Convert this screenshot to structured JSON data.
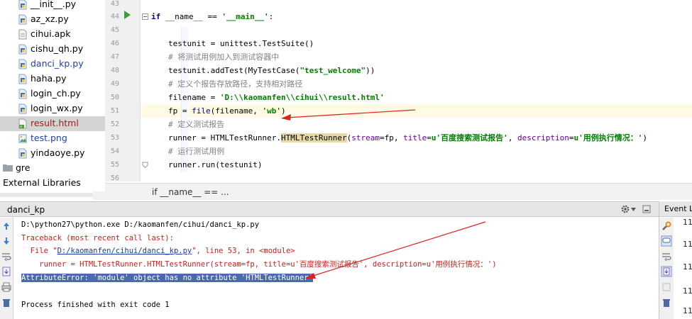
{
  "project_tree": {
    "items": [
      {
        "label": "__init__.py",
        "icon": "python-file-icon",
        "vcs": "none"
      },
      {
        "label": "az_xz.py",
        "icon": "python-file-icon",
        "vcs": "none"
      },
      {
        "label": "cihui.apk",
        "icon": "file-icon",
        "vcs": "none"
      },
      {
        "label": "cishu_qh.py",
        "icon": "python-file-icon",
        "vcs": "none"
      },
      {
        "label": "danci_kp.py",
        "icon": "python-file-icon",
        "vcs": "modified"
      },
      {
        "label": "haha.py",
        "icon": "python-file-icon",
        "vcs": "none"
      },
      {
        "label": "login_ch.py",
        "icon": "python-file-icon",
        "vcs": "none"
      },
      {
        "label": "login_wx.py",
        "icon": "python-file-icon",
        "vcs": "none"
      },
      {
        "label": "result.html",
        "icon": "html-file-icon",
        "vcs": "unversioned",
        "selected": true
      },
      {
        "label": "test.png",
        "icon": "image-file-icon",
        "vcs": "modified"
      },
      {
        "label": "yindaoye.py",
        "icon": "python-file-icon",
        "vcs": "none"
      },
      {
        "label": "gre",
        "icon": "folder-icon",
        "vcs": "none"
      },
      {
        "label": "External Libraries",
        "icon": "library-icon",
        "vcs": "none"
      }
    ]
  },
  "editor": {
    "line_numbers": [
      "43",
      "44",
      "45",
      "46",
      "47",
      "48",
      "49",
      "50",
      "51",
      "52",
      "53",
      "54",
      "55",
      "56"
    ],
    "current_line": "51",
    "lines": {
      "l44_kw": "if",
      "l44_a": " __name__ == ",
      "l44_str": "'__main__'",
      "l44_b": ":",
      "l46": "testunit = unittest.TestSuite()",
      "l47": "# 将测试用例加入到测试容器中",
      "l48_a": "testunit.addTest(MyTestCase(",
      "l48_str": "\"test_welcome\"",
      "l48_b": "))",
      "l49": "# 定义个报告存放路径，支持相对路径",
      "l50_a": "filename = ",
      "l50_str": "'D:\\\\kaomanfen\\\\cihui\\\\result.html'",
      "l51_a": "fp = ",
      "l51_bi": "file",
      "l51_b": "(filename, ",
      "l51_str": "'wb'",
      "l51_c": ")",
      "l52": "# 定义测试报告",
      "l53_a": "runner = HTMLTestRunner.",
      "l53_hl": "HTMLTestRunner",
      "l53_b": "(",
      "l53_p1": "stream",
      "l53_c": "=fp, ",
      "l53_p2": "title",
      "l53_d": "=",
      "l53_str1": "u'百度搜索测试报告'",
      "l53_e": ", ",
      "l53_p3": "description",
      "l53_f": "=",
      "l53_str2": "u'用例执行情况：'",
      "l53_g": ")",
      "l54": "# 运行测试用例",
      "l55": "runner.run(testunit)"
    },
    "breadcrumb": "if __name__ == ..."
  },
  "run_panel": {
    "title": "danci_kp",
    "console": {
      "cmd": "D:\\python27\\python.exe D:/kaomanfen/cihui/danci_kp.py",
      "traceback": "Traceback (most recent call last):",
      "file_a": "  File \"",
      "file_link": "D:/kaomanfen/cihui/danci_kp.py",
      "file_b": "\", line 53, in <module>",
      "code": "    runner = HTMLTestRunner.HTMLTestRunner(stream=fp, title=u'百度搜索测试报告', description=u'用例执行情况：')",
      "error": "AttributeError: 'module' object has no attribute 'HTMLTestRunner'",
      "finished": "Process finished with exit code 1"
    }
  },
  "event_log": {
    "title": "Event Log",
    "entries": [
      "11",
      "11",
      "11",
      "11",
      "11",
      "12"
    ]
  },
  "colors": {
    "annotation_arrow": "#e01f1f",
    "selection": "#4a6aa8",
    "current_line": "#fffae3"
  }
}
